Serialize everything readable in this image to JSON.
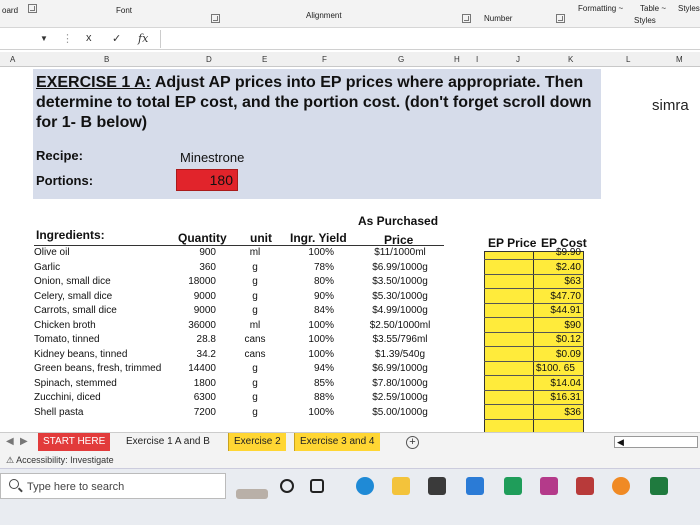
{
  "ribbon": {
    "board_label": "oard",
    "font_label": "Font",
    "alignment_label": "Alignment",
    "number_label": "Number",
    "formatting_label": "Formatting ~",
    "table_label": "Table ~",
    "styles_label": "Styles",
    "styles_btn": "Styles"
  },
  "formula_bar": {
    "fx_label": "fx",
    "cancel_icon": "x",
    "enter_icon": "✓"
  },
  "columns": [
    "A",
    "B",
    "D",
    "E",
    "F",
    "G",
    "H",
    "I",
    "J",
    "K",
    "L",
    "M"
  ],
  "sheet": {
    "exercise_title": "EXERCISE 1 A:",
    "exercise_text": " Adjust AP prices into EP prices where appropriate. Then determine to total EP cost, and the portion cost. (don't forget scroll down for 1- B below)",
    "recipe_label": "Recipe:",
    "recipe_value": "Minestrone",
    "portions_label": "Portions:",
    "portions_value": "180",
    "side_name": "simra"
  },
  "table": {
    "headers": {
      "ingredients": "Ingredients:",
      "quantity": "Quantity",
      "unit": "unit",
      "yield": "Ingr. Yield",
      "as_purchased": "As Purchased",
      "price": "Price",
      "ep_price": "EP Price",
      "ep_cost": "EP Cost"
    },
    "rows": [
      {
        "name": "Olive oil",
        "qty": "900",
        "unit": "ml",
        "yield": "100%",
        "price": "$11/1000ml",
        "ep": "$9.90"
      },
      {
        "name": "Garlic",
        "qty": "360",
        "unit": "g",
        "yield": "78%",
        "price": "$6.99/1000g",
        "ep": "$2.40"
      },
      {
        "name": "Onion, small dice",
        "qty": "18000",
        "unit": "g",
        "yield": "80%",
        "price": "$3.50/1000g",
        "ep": "$63"
      },
      {
        "name": "Celery, small dice",
        "qty": "9000",
        "unit": "g",
        "yield": "90%",
        "price": "$5.30/1000g",
        "ep": "$47.70"
      },
      {
        "name": "Carrots, small dice",
        "qty": "9000",
        "unit": "g",
        "yield": "84%",
        "price": "$4.99/1000g",
        "ep": "$44.91"
      },
      {
        "name": "Chicken broth",
        "qty": "36000",
        "unit": "ml",
        "yield": "100%",
        "price": "$2.50/1000ml",
        "ep": "$90"
      },
      {
        "name": "Tomato, tinned",
        "qty": "28.8",
        "unit": "cans",
        "yield": "100%",
        "price": "$3.55/796ml",
        "ep": "$0.12"
      },
      {
        "name": "Kidney beans, tinned",
        "qty": "34.2",
        "unit": "cans",
        "yield": "100%",
        "price": "$1.39/540g",
        "ep": "$0.09"
      },
      {
        "name": "Green beans, fresh, trimmed",
        "qty": "14400",
        "unit": "g",
        "yield": "94%",
        "price": "$6.99/1000g",
        "ep": "$100. 65"
      },
      {
        "name": "Spinach, stemmed",
        "qty": "1800",
        "unit": "g",
        "yield": "85%",
        "price": "$7.80/1000g",
        "ep": "$14.04"
      },
      {
        "name": "Zucchini, diced",
        "qty": "6300",
        "unit": "g",
        "yield": "88%",
        "price": "$2.59/1000g",
        "ep": "$16.31"
      },
      {
        "name": "Shell pasta",
        "qty": "7200",
        "unit": "g",
        "yield": "100%",
        "price": "$5.00/1000g",
        "ep": "$36"
      }
    ]
  },
  "tabs": {
    "start": "START HERE",
    "ex1": "Exercise 1 A and B",
    "ex2": "Exercise 2",
    "ex3": "Exercise 3 and 4",
    "add": "+"
  },
  "status": {
    "accessibility": "Accessibility: Investigate"
  },
  "taskbar": {
    "search_placeholder": "Type here to search"
  },
  "colors": {
    "title_band": "#d6dcea",
    "portion_red": "#e1242b",
    "ep_yellow": "#ffeb3b",
    "tab_start": "#e23b3b",
    "tab_yellow": "#ffd633"
  }
}
